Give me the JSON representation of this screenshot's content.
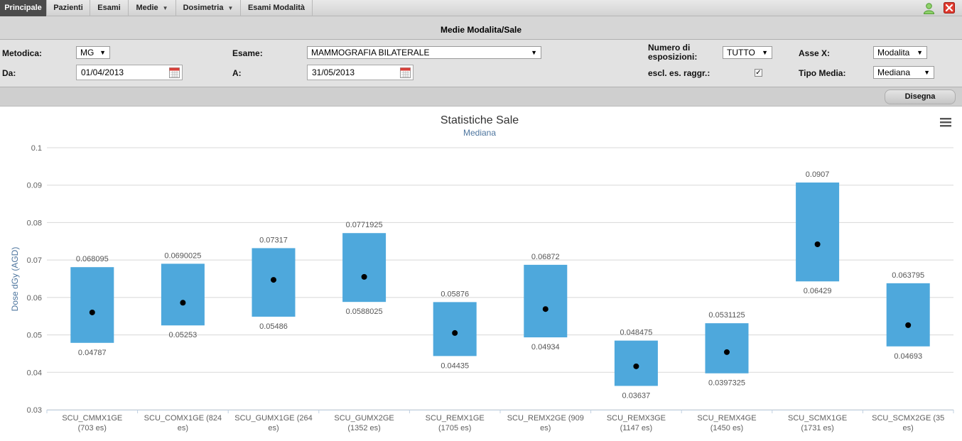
{
  "nav": {
    "items": [
      {
        "label": "Principale",
        "active": true
      },
      {
        "label": "Pazienti"
      },
      {
        "label": "Esami"
      },
      {
        "label": "Medie",
        "dropdown": true
      },
      {
        "label": "Dosimetria",
        "dropdown": true
      },
      {
        "label": "Esami Modalità"
      }
    ],
    "user_icon": "user-icon",
    "close_icon": "close-icon"
  },
  "page_title": "Medie Modalita/Sale",
  "filters": {
    "metodica": {
      "label": "Metodica:",
      "value": "MG"
    },
    "da": {
      "label": "Da:",
      "value": "01/04/2013"
    },
    "esame": {
      "label": "Esame:",
      "value": "MAMMOGRAFIA BILATERALE"
    },
    "a": {
      "label": "A:",
      "value": "31/05/2013"
    },
    "numero_esposizioni": {
      "label_line1": "Numero di",
      "label_line2": "esposizioni:",
      "value": "TUTTO"
    },
    "escl_raggr": {
      "label": "escl. es. raggr.:",
      "checked": true
    },
    "asse_x": {
      "label": "Asse X:",
      "value": "Modalita"
    },
    "tipo_media": {
      "label": "Tipo Media:",
      "value": "Mediana"
    }
  },
  "actions": {
    "draw_label": "Disegna"
  },
  "chart": {
    "title": "Statistiche Sale",
    "subtitle": "Mediana",
    "menu_icon": "hamburger-menu-icon",
    "bar_color": "#4ea8dc",
    "dot_color": "#000000"
  },
  "chart_data": {
    "type": "range-bar",
    "ylabel": "Dose dGy (AGD)",
    "ylim": [
      0.03,
      0.1
    ],
    "yticks": [
      "0.03",
      "0.04",
      "0.05",
      "0.06",
      "0.07",
      "0.08",
      "0.09",
      "0.1"
    ],
    "grid": true,
    "categories": [
      {
        "line1": "SCU_CMMX1GE",
        "line2": "(703 es)"
      },
      {
        "line1": "SCU_COMX1GE (824",
        "line2": "es)"
      },
      {
        "line1": "SCU_GUMX1GE (264",
        "line2": "es)"
      },
      {
        "line1": "SCU_GUMX2GE",
        "line2": "(1352 es)"
      },
      {
        "line1": "SCU_REMX1GE",
        "line2": "(1705 es)"
      },
      {
        "line1": "SCU_REMX2GE (909",
        "line2": "es)"
      },
      {
        "line1": "SCU_REMX3GE",
        "line2": "(1147 es)"
      },
      {
        "line1": "SCU_REMX4GE",
        "line2": "(1450 es)"
      },
      {
        "line1": "SCU_SCMX1GE",
        "line2": "(1731 es)"
      },
      {
        "line1": "SCU_SCMX2GE (35",
        "line2": "es)"
      }
    ],
    "high": [
      0.068095,
      0.0690025,
      0.07317,
      0.0771925,
      0.05876,
      0.06872,
      0.048475,
      0.0531125,
      0.0907,
      0.063795
    ],
    "low": [
      0.04787,
      0.05253,
      0.05486,
      0.0588025,
      0.04435,
      0.04934,
      0.03637,
      0.0397325,
      0.06429,
      0.04693
    ],
    "high_labels": [
      "0.068095",
      "0.0690025",
      "0.07317",
      "0.0771925",
      "0.05876",
      "0.06872",
      "0.048475",
      "0.0531125",
      "0.0907",
      "0.063795"
    ],
    "low_labels": [
      "0.04787",
      "0.05253",
      "0.05486",
      "0.0588025",
      "0.04435",
      "0.04934",
      "0.03637",
      "0.0397325",
      "0.06429",
      "0.04693"
    ],
    "median": [
      0.056,
      0.0586,
      0.0647,
      0.0655,
      0.0505,
      0.0569,
      0.0416,
      0.0454,
      0.0742,
      0.0526
    ]
  }
}
